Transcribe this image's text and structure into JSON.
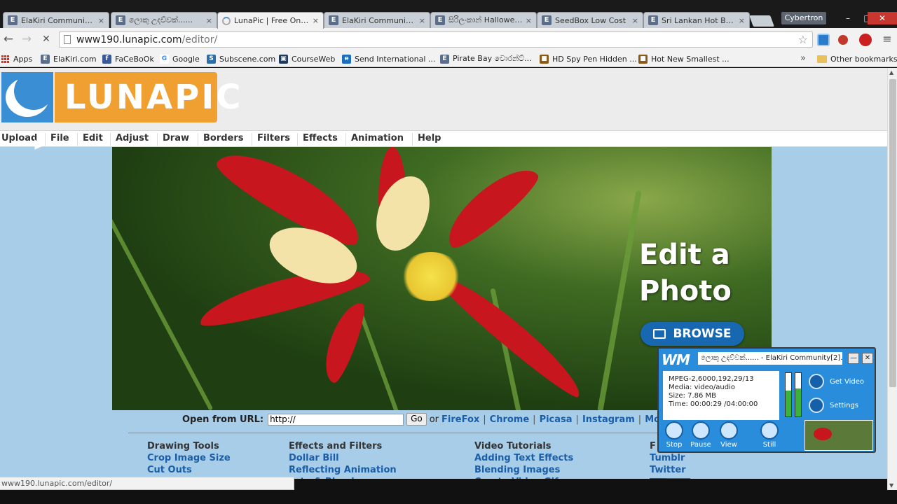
{
  "tabs": [
    {
      "title": "ElaKiri Community - ",
      "icon": "ek-icon",
      "active": false
    },
    {
      "title": "ලොකු උදව්වක්......",
      "icon": "ek-icon",
      "active": false
    },
    {
      "title": "LunaPic | Free Online",
      "icon": "loading-icon",
      "active": true
    },
    {
      "title": "ElaKiri Community - ",
      "icon": "ek-icon",
      "active": false
    },
    {
      "title": "සිරිලංකාන් Halloween",
      "icon": "ek-icon",
      "active": false
    },
    {
      "title": "SeedBox Low Cost ",
      "icon": "ek-icon",
      "active": false
    },
    {
      "title": "Sri Lankan Hot Babe",
      "icon": "ek-icon",
      "active": false
    }
  ],
  "tab_close_glyph": "×",
  "favicon_letter": "E",
  "profile_name": "Cybertron",
  "window_controls": {
    "minimize": "–",
    "maximize": "□",
    "close": "✕"
  },
  "nav": {
    "back": "←",
    "forward": "→",
    "stop": "✕"
  },
  "address": {
    "host": "www190.lunapic.com",
    "path": "/editor/"
  },
  "star_glyph": "☆",
  "menu_glyph": "≡",
  "bookmarks": [
    {
      "label": "Apps",
      "icon": "apps-grid-icon"
    },
    {
      "label": "ElaKiri.com",
      "icon": "ek-icon",
      "color": "#5a6e8c",
      "glyph": "E"
    },
    {
      "label": "FaCeBoOk",
      "icon": "facebook-icon",
      "color": "#3b5998",
      "glyph": "f"
    },
    {
      "label": "Google",
      "icon": "google-icon",
      "color": "#ffffff",
      "glyph": "G"
    },
    {
      "label": "Subscene.com",
      "icon": "subscene-icon",
      "color": "#2b6ea8",
      "glyph": "S"
    },
    {
      "label": "CourseWeb",
      "icon": "courseweb-icon",
      "color": "#1e3a60",
      "glyph": "▣"
    },
    {
      "label": "Send International ...",
      "icon": "ie-icon",
      "color": "#1b6fc2",
      "glyph": "e"
    },
    {
      "label": "Pirate Bay වොරන්ට්...",
      "icon": "ek-icon",
      "color": "#5a6e8c",
      "glyph": "E"
    },
    {
      "label": "HD Spy Pen Hidden ...",
      "icon": "bag-icon",
      "color": "#8b5a18",
      "glyph": "■"
    },
    {
      "label": "Hot New Smallest ...",
      "icon": "bag-icon",
      "color": "#8b5a18",
      "glyph": "■"
    }
  ],
  "bookmarks_overflow": "»",
  "other_bookmarks": "Other bookmarks",
  "logo_text": "LUNAPIC",
  "menu": [
    "Upload",
    "File",
    "Edit",
    "Adjust",
    "Draw",
    "Borders",
    "Filters",
    "Effects",
    "Animation",
    "Help"
  ],
  "hero": {
    "title_line1": "Edit a",
    "title_line2": "Photo",
    "browse_label": "BROWSE"
  },
  "url_row": {
    "label": "Open from URL:",
    "input_value": "http://",
    "go_label": "Go",
    "or_text": "or",
    "links": [
      "FireFox",
      "Chrome",
      "Picasa",
      "Instagram",
      "More Uploa"
    ]
  },
  "columns": [
    {
      "head": "Drawing Tools",
      "links": [
        "Crop Image Size",
        "Cut Outs"
      ]
    },
    {
      "head": "Effects and Filters",
      "links": [
        "Dollar Bill",
        "Reflecting Animation",
        "aste & Blend"
      ]
    },
    {
      "head": "Video Tutorials",
      "links": [
        "Adding Text Effects",
        "Blending Images",
        "Create Video Gifs"
      ]
    },
    {
      "head": "F",
      "links": [
        "Tumblr",
        "Twitter"
      ]
    }
  ],
  "status_url": "www190.lunapic.com/editor/",
  "recorder": {
    "logo": "WM",
    "title": "ලොකු උදව්වක්...... - ElaKiri Community[2].mp4",
    "info": [
      "MPEG-2,6000,192,29/13",
      "Media: video/audio",
      "Size: 7.86  MB",
      "Time: 00:00:29  /04:00:00"
    ],
    "meter_levels": [
      0.6,
      0.65
    ],
    "side_buttons": [
      "Get Video",
      "Settings"
    ],
    "buttons": [
      "Stop",
      "Pause",
      "View",
      "Still"
    ],
    "minimize": "—",
    "close": "✕"
  }
}
